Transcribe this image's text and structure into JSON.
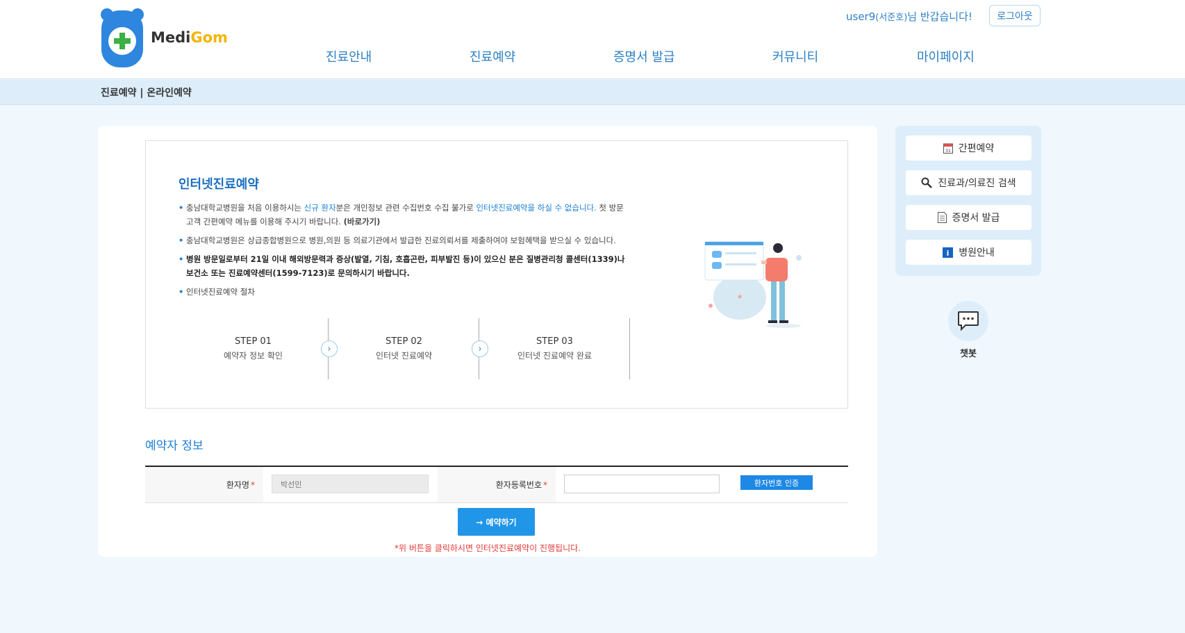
{
  "header": {
    "logo_text_1": "Medi",
    "logo_text_2": "Gom",
    "greeting_user": "user9",
    "greeting_name": "(서준호)",
    "greeting_suffix": "님 반갑습니다!",
    "logout_label": "로그아웃"
  },
  "nav": {
    "items": [
      "진료안내",
      "진료예약",
      "증명서 발급",
      "커뮤니티",
      "마이페이지"
    ]
  },
  "breadcrumb": "진료예약 | 온라인예약",
  "info": {
    "title": "인터넷진료예약",
    "b1_pre": "충남대학교병원을 처음 이용하시는 ",
    "b1_hl1": "신규 환자",
    "b1_mid": "분은 개인정보 관련 수집번호 수집 불가로 ",
    "b1_hl2": "인터넷진료예약을 하실 수 없습니다.",
    "b1_post": " 첫 방문고객 간편예약 메뉴를 이용해 주시기 바랍니다. ",
    "b1_link": "(바로가기)",
    "b2": "충남대학교병원은 상급종합병원으로 병원,의원 등 의료기관에서 발급한 진료의뢰서를 제출하여야 보험혜택을 받으실 수 있습니다.",
    "b3": "병원 방문일로부터 21일 이내 해외방문력과 증상(발열, 기침, 호흡곤란, 피부발진 등)이 있으신 분은 질병관리청 콜센터(1339)나 보건소 또는 진료예약센터(1599-7123)로 문의하시기 바랍니다.",
    "b4": "인터넷진료예약 절차",
    "steps": [
      {
        "num": "STEP 01",
        "label": "예약자 정보 확인"
      },
      {
        "num": "STEP 02",
        "label": "인터넷 진료예약"
      },
      {
        "num": "STEP 03",
        "label": "인터넷 진료예약 완료"
      }
    ]
  },
  "form": {
    "section_title": "예약자 정보",
    "name_label": "환자명",
    "name_value": "박선민",
    "reg_label": "환자등록번호",
    "verify_label": "환자번호 인증",
    "reserve_label": "→ 예약하기",
    "notice": "*위 버튼을 클릭하시면 인터넷진료예약이 진행됩니다."
  },
  "sidebar": {
    "items": [
      "간편예약",
      "진료과/의료진 검색",
      "증명서 발급",
      "병원안내"
    ],
    "chatbot_label": "챗봇"
  },
  "colors": {
    "accent": "#2b7fc4",
    "button_blue": "#2196e8",
    "light_bg": "#ddeefa",
    "warning": "#e53935"
  }
}
